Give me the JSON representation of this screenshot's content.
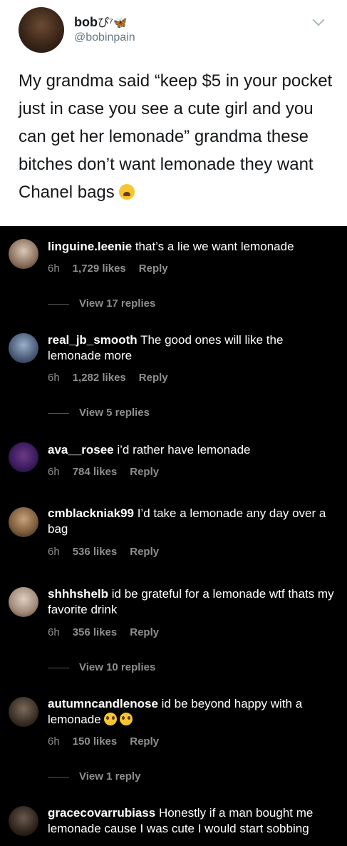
{
  "tweet": {
    "display_name": "bob",
    "display_name_suffix": "ぴ⁷🦋",
    "handle": "@bobinpain",
    "text": "My grandma said “keep $5 in your pocket just in case you see a cute girl and you can get her lemonade” grandma these bitches don’t want lemonade they want Chanel bags",
    "emoji": "weary-face"
  },
  "comments": [
    {
      "user": "linguine.leenie",
      "text": "that’s a lie we want lemonade",
      "time": "6h",
      "likes": "1,729 likes",
      "reply": "Reply",
      "view_replies": "View 17 replies"
    },
    {
      "user": "real_jb_smooth",
      "text": "The good ones will like the lemonade more",
      "time": "6h",
      "likes": "1,282 likes",
      "reply": "Reply",
      "view_replies": "View 5 replies"
    },
    {
      "user": "ava__rosee",
      "text": "i’d rather have lemonade",
      "time": "6h",
      "likes": "784 likes",
      "reply": "Reply"
    },
    {
      "user": "cmblackniak99",
      "text": "I’d take a lemonade any day over a bag",
      "time": "6h",
      "likes": "536 likes",
      "reply": "Reply"
    },
    {
      "user": "shhhshelb",
      "text": "id be grateful for a lemonade wtf thats my favorite drink",
      "time": "6h",
      "likes": "356 likes",
      "reply": "Reply",
      "view_replies": "View 10 replies"
    },
    {
      "user": "autumncandlenose",
      "text": "id be beyond happy with a lemonade",
      "time": "6h",
      "likes": "150 likes",
      "reply": "Reply",
      "view_replies": "View 1 reply",
      "emojis": [
        "pleading-face",
        "pleading-face"
      ]
    },
    {
      "user": "gracecovarrubiass",
      "text": "Honestly if a man bought me lemonade cause I was cute I would start sobbing"
    }
  ],
  "colors": {
    "tweet_bg": "#ffffff",
    "comments_bg": "#000000",
    "meta": "#8e8e8e",
    "handle": "#657786"
  }
}
